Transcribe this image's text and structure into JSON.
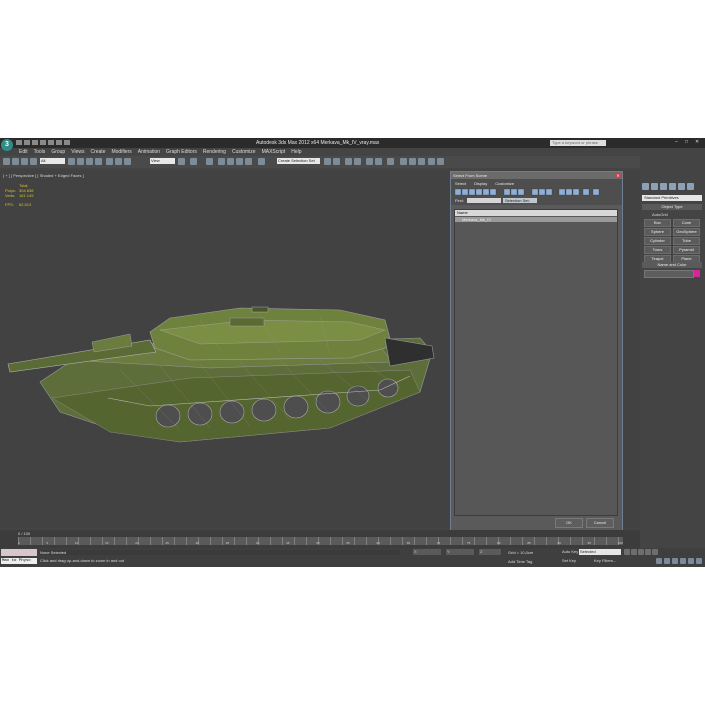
{
  "app": {
    "title": "Autodesk 3ds Max 2012 x64     Merkava_Mk_IV_vray.max",
    "search_placeholder": "Type a keyword or phrase",
    "logo": "3"
  },
  "menu": [
    "Edit",
    "Tools",
    "Group",
    "Views",
    "Create",
    "Modifiers",
    "Animation",
    "Graph Editors",
    "Rendering",
    "Customize",
    "MAXScript",
    "Help"
  ],
  "toolbar": {
    "filter_value": "All",
    "view_value": "View",
    "selection_set_value": "Create Selection Set"
  },
  "viewport": {
    "label": "[ + ] [ Perspective ] [ Shaded + Edged Faces ]",
    "stats_header": "Total",
    "polys_label": "Polys:",
    "polys_value": "304 838",
    "verts_label": "Verts:",
    "verts_value": "161 149",
    "fps_label": "FPS:",
    "fps_value": "62,913"
  },
  "select_dialog": {
    "title": "Select From Scene",
    "tabs": [
      "Select",
      "Display",
      "Customize"
    ],
    "find_label": "Find:",
    "selection_set_label": "Selection Set:",
    "column_name": "Name",
    "items": [
      "Merkava_Mk_IV"
    ],
    "ok_label": "OK",
    "cancel_label": "Cancel"
  },
  "command_panel": {
    "category_select": "Standard Primitives",
    "object_type_title": "Object Type",
    "autogrid_label": "AutoGrid",
    "objects": [
      "Box",
      "Cone",
      "Sphere",
      "GeoSphere",
      "Cylinder",
      "Tube",
      "Torus",
      "Pyramid",
      "Teapot",
      "Plane"
    ],
    "name_color_title": "Name and Color",
    "color_hex": "#d6259b"
  },
  "timeline": {
    "counter": "0 / 100",
    "ticks": [
      "0",
      "5",
      "10",
      "15",
      "20",
      "25",
      "30",
      "35",
      "40",
      "45",
      "50",
      "55",
      "60",
      "65",
      "70",
      "75",
      "80",
      "85",
      "90",
      "95",
      "100"
    ]
  },
  "status": {
    "maxscript_text": "Max to Physc",
    "selection_text": "None Selected",
    "hint_text": "Click and drag up-and-down to zoom in and out",
    "x_label": "X:",
    "y_label": "Y:",
    "z_label": "Z:",
    "grid_text": "Grid = 10,0cm",
    "auto_key_label": "Auto Key",
    "selected_value": "Selected",
    "set_key_label": "Set Key",
    "key_filters_label": "Key Filters...",
    "add_time_tag": "Add Time Tag"
  }
}
